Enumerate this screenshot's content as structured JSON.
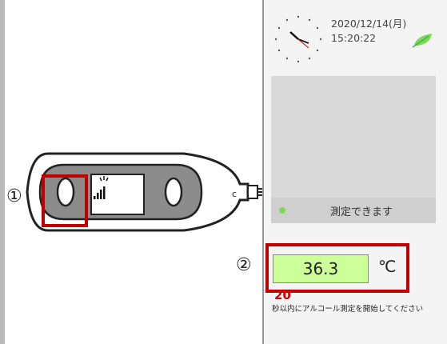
{
  "clock": {
    "date": "2020/12/14(月)",
    "time": "15:20:22"
  },
  "device": {
    "callout_1": "①",
    "connector_label": "c"
  },
  "status": {
    "text": "測定できます"
  },
  "measurement": {
    "callout_2": "②",
    "value": "36.3",
    "unit": "℃"
  },
  "countdown": {
    "seconds": "20"
  },
  "instruction": {
    "text": "秒以内にアルコール測定を開始してください"
  },
  "colors": {
    "highlight": "#c00000",
    "value_bg": "#ccff99",
    "status_ok": "#7ed957",
    "countdown": "#d00000"
  },
  "icons": {
    "status": "leaf-icon"
  }
}
